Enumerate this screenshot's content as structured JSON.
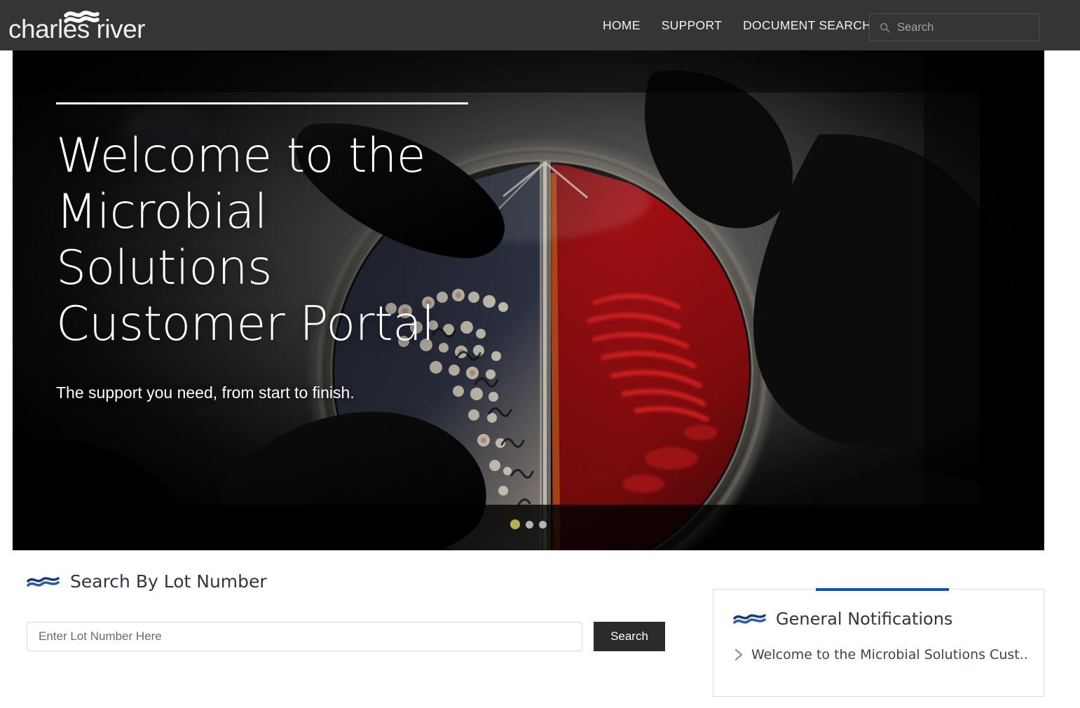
{
  "header": {
    "brand_name": "charles river",
    "brand_icon": "wave-logo-icon",
    "nav": [
      {
        "label": "HOME",
        "name": "nav-home"
      },
      {
        "label": "SUPPORT",
        "name": "nav-support"
      },
      {
        "label": "DOCUMENT SEARCH",
        "name": "nav-document-search"
      }
    ],
    "search": {
      "icon": "search-icon",
      "placeholder": "Search",
      "value": ""
    },
    "background_color": "#353535"
  },
  "hero": {
    "title": "Welcome to the Microbial Solutions Customer Portal",
    "subtitle": "The support you need, from start to finish.",
    "image_description": "gloved hands holding a bi-plate petri dish with bacterial colonies",
    "carousel": {
      "total_slides": 3,
      "active_slide": 1
    }
  },
  "lot_search": {
    "icon": "wave-logo-icon",
    "title": "Search By Lot Number",
    "input_placeholder": "Enter Lot Number Here",
    "input_value": "",
    "button_label": "Search"
  },
  "notifications": {
    "icon": "wave-logo-icon",
    "title": "General Notifications",
    "accent_color": "#1a4fa8",
    "items": [
      {
        "icon": "chevron-right-icon",
        "text": "Welcome to the Microbial Solutions Cust..."
      }
    ]
  }
}
